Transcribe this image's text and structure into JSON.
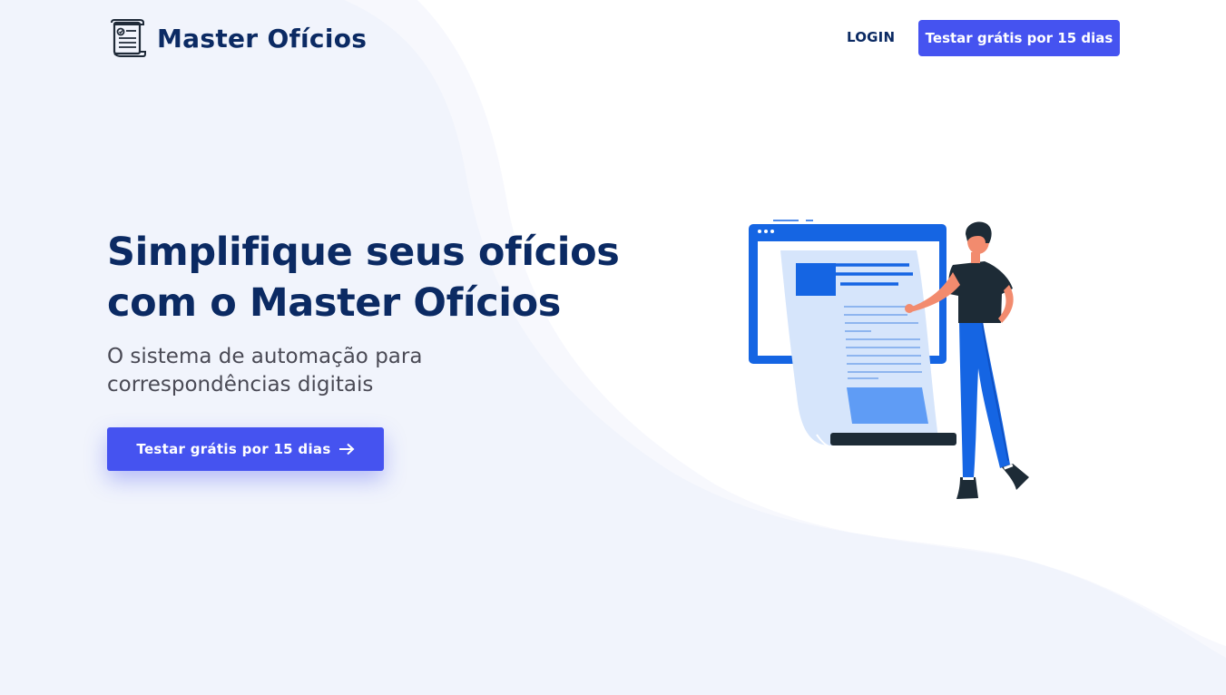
{
  "brand": {
    "name": "Master Ofícios",
    "logo_icon": "document-scroll-icon"
  },
  "nav": {
    "login_label": "LOGIN",
    "cta_label": "Testar grátis por 15 dias"
  },
  "hero": {
    "title_line1": "Simplifique seus ofícios",
    "title_line2": "com o Master Ofícios",
    "subtitle_line1": "O sistema de automação para",
    "subtitle_line2": "correspondências digitais",
    "cta_label": "Testar grátis por 15 dias",
    "cta_icon": "arrow-right-icon"
  },
  "illustration": {
    "icon": "person-with-document-illustration"
  },
  "colors": {
    "primary": "#4553f0",
    "heading": "#0b2a63",
    "body_text": "#4a4a55",
    "background_wave": "#f1f4fc",
    "illustration_blue": "#1565e3"
  }
}
